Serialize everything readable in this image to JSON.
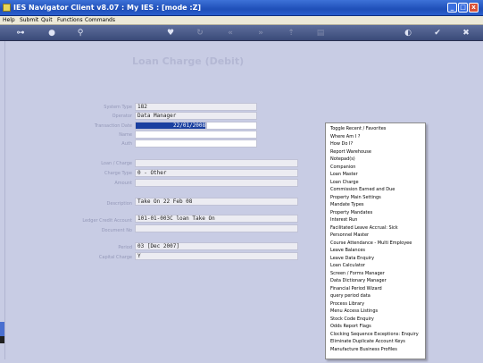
{
  "window": {
    "title": "IES Navigator Client v8.07 : My IES :      [mode :Z]",
    "min_label": "_",
    "max_label": "□",
    "close_label": "x"
  },
  "menu": [
    "Help",
    "Submit",
    "Quit",
    "Functions",
    "Commands"
  ],
  "toolbar": {
    "icons": [
      "key-icon",
      "info-icon",
      "search-icon",
      "heart-icon",
      "refresh-icon",
      "rewind-icon",
      "fast-forward-icon",
      "upload-icon",
      "document-icon",
      "globe-icon",
      "check-icon",
      "close-icon"
    ]
  },
  "form": {
    "title": "Loan Charge (Debit)",
    "fields": [
      {
        "label": "System Type",
        "value": "182"
      },
      {
        "label": "Operator",
        "value": "Data Manager"
      },
      {
        "label": "Transaction Date",
        "value": "22/01/2008"
      },
      {
        "label": "Name",
        "value": ""
      },
      {
        "label": "Auth",
        "value": ""
      },
      {
        "label": "Loan / Charge",
        "value": ""
      },
      {
        "label": "Charge Type",
        "value": "0 - Other"
      },
      {
        "label": "Amount",
        "value": ""
      },
      {
        "label": "Description",
        "value": "Take On 22 Feb 08"
      },
      {
        "label": "Ledger Credit Account",
        "value": "101-01-003C loan Take On"
      },
      {
        "label": "Document No",
        "value": ""
      },
      {
        "label": "Period",
        "value": "03  [Dec 2007]"
      },
      {
        "label": "Capital Charge",
        "value": "Y"
      }
    ]
  },
  "context_menu": {
    "items": [
      "Toggle Recent / Favorites",
      "Where Am I ?",
      "How Do I?",
      "Report Warehouse",
      "Notepad(s)",
      "Companion",
      "Loan Master",
      "Loan Charge",
      "Commission Earned and Due",
      "Property Main Settings",
      "Mandate Types",
      "Property Mandates",
      "Interest Run",
      "Facilitated Leave Accrual: Sick",
      "Personnel Master",
      "Course Attendance - Multi Employee",
      "Leave Balances",
      "Leave Data Enquiry",
      "Loan Calculator",
      "Screen / Forms Manager",
      "Data Dictionary Manager",
      "Financial Period Wizard",
      "query period data",
      "Process Library",
      "Menu Access Listings",
      "Stock Code Enquiry",
      "Odds Report Flags",
      "Clocking Sequence Exceptions: Enquiry",
      "Eliminate Duplicate Account Keys",
      "Manufacture Business Profiles"
    ]
  }
}
